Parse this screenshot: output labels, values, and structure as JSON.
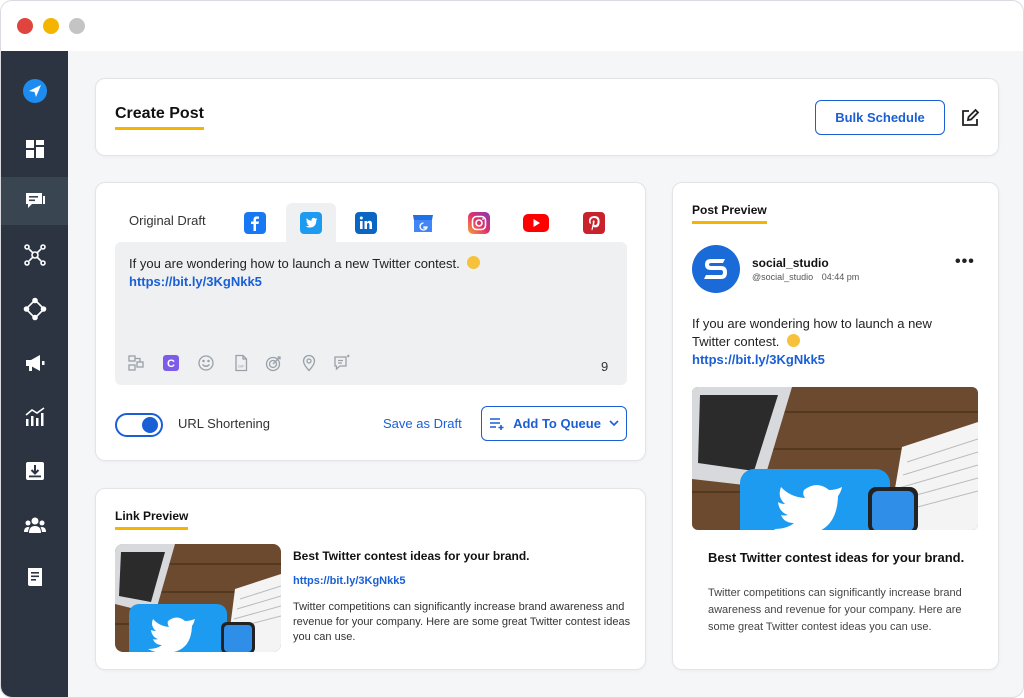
{
  "header": {
    "title": "Create Post",
    "bulk_schedule_label": "Bulk Schedule"
  },
  "sidebar": {
    "items": [
      {
        "icon": "send-logo-icon"
      },
      {
        "icon": "dashboard-icon"
      },
      {
        "icon": "compose-icon",
        "active": true
      },
      {
        "icon": "network-icon"
      },
      {
        "icon": "diamond-nodes-icon"
      },
      {
        "icon": "megaphone-icon"
      },
      {
        "icon": "analytics-icon"
      },
      {
        "icon": "download-icon"
      },
      {
        "icon": "team-icon"
      },
      {
        "icon": "report-icon"
      }
    ]
  },
  "composer": {
    "original_draft_label": "Original Draft",
    "networks": [
      "facebook",
      "twitter",
      "linkedin",
      "google-business",
      "instagram",
      "youtube",
      "pinterest"
    ],
    "active_network": "twitter",
    "text": "If you are wondering how to launch a new Twitter contest.",
    "link": "https://bit.ly/3KgNkk5",
    "char_count": "9",
    "url_shortening_label": "URL Shortening",
    "save_draft_label": "Save as Draft",
    "add_to_queue_label": "Add To Queue"
  },
  "link_preview": {
    "title": "Link Preview",
    "headline": "Best Twitter contest ideas for your brand.",
    "url": "https://bit.ly/3KgNkk5",
    "description": "Twitter competitions can significantly increase brand awareness and revenue for your company. Here are some great Twitter contest ideas you can use."
  },
  "post_preview": {
    "title": "Post Preview",
    "account_name": "social_studio",
    "handle": "@social_studio",
    "time": "04:44 pm",
    "text": "If you are wondering how to launch a new Twitter contest.",
    "link": "https://bit.ly/3KgNkk5",
    "headline": "Best Twitter contest ideas for your brand.",
    "description": "Twitter competitions can significantly increase brand awareness and revenue for your company. Here are some great Twitter contest ideas you can use."
  },
  "colors": {
    "accent": "#1a5fd6",
    "sidebar": "#2b3440",
    "underline": "#f5b400",
    "twitter": "#1d9bf0"
  }
}
